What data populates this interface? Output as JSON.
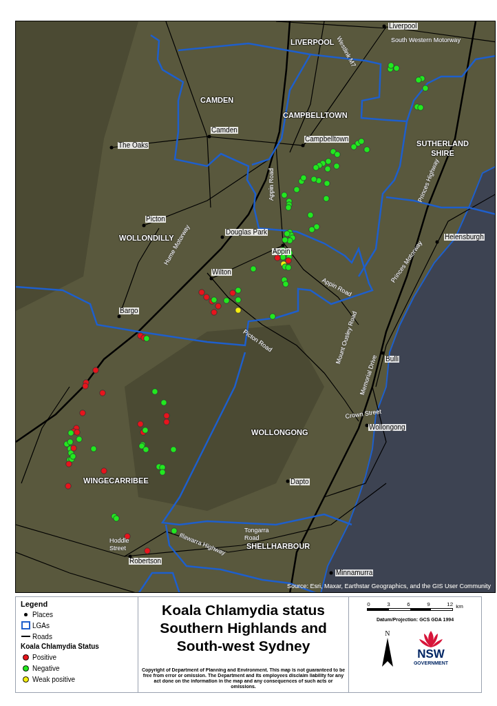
{
  "map": {
    "lgas": [
      "LIVERPOOL",
      "CAMDEN",
      "CAMPBELLTOWN",
      "SUTHERLAND SHIRE",
      "WOLLONDILLY",
      "WOLLONGONG",
      "WINGECARRIBEE",
      "SHELLHARBOUR"
    ],
    "towns": [
      "Liverpool",
      "The Oaks",
      "Camden",
      "Campbelltown",
      "Picton",
      "Douglas Park",
      "Helensburgh",
      "Appin",
      "Wilton",
      "Bargo",
      "Bulli",
      "Wollongong",
      "Dapto",
      "Robertson",
      "Minnamurra"
    ],
    "roads": [
      "Westlink M7",
      "South Western Motorway",
      "Appin Road",
      "Princes Highway",
      "Hume Motorway",
      "Appin Road",
      "Princes Motorway",
      "Picton Road",
      "Mount Ousley Road",
      "Memorial Drive",
      "Crown Street",
      "Illawarra Highway",
      "Tongarra Road",
      "Hoddle Street"
    ],
    "source": "Source: Esri, Maxar, Earthstar Geographics, and the GIS User Community"
  },
  "legend": {
    "title": "Legend",
    "items": [
      {
        "kind": "point",
        "label": "Places"
      },
      {
        "kind": "area",
        "label": "LGAs"
      },
      {
        "kind": "line",
        "label": "Roads"
      }
    ],
    "status_title": "Koala Chlamydia Status",
    "statuses": [
      {
        "label": "Positive",
        "color": "#e8141c"
      },
      {
        "label": "Negative",
        "color": "#22e81f"
      },
      {
        "label": "Weak positive",
        "color": "#f5ee10"
      }
    ]
  },
  "title": "Koala Chlamydia status Southern Highlands and South-west Sydney",
  "copyright": "Copyright of Department of Planning and Environment. This map is not guaranteed to be free from error or omission. The Department and its employees disclaim liability for any act done on the information in the map and any consequences of such acts or omissions.",
  "scale": {
    "ticks": [
      "0",
      "3",
      "6",
      "9",
      "12"
    ],
    "unit": "km"
  },
  "datum": "Datum/Projection: GCS GDA 1994",
  "north": "N",
  "logo": {
    "name": "NSW",
    "subtitle": "GOVERNMENT"
  }
}
